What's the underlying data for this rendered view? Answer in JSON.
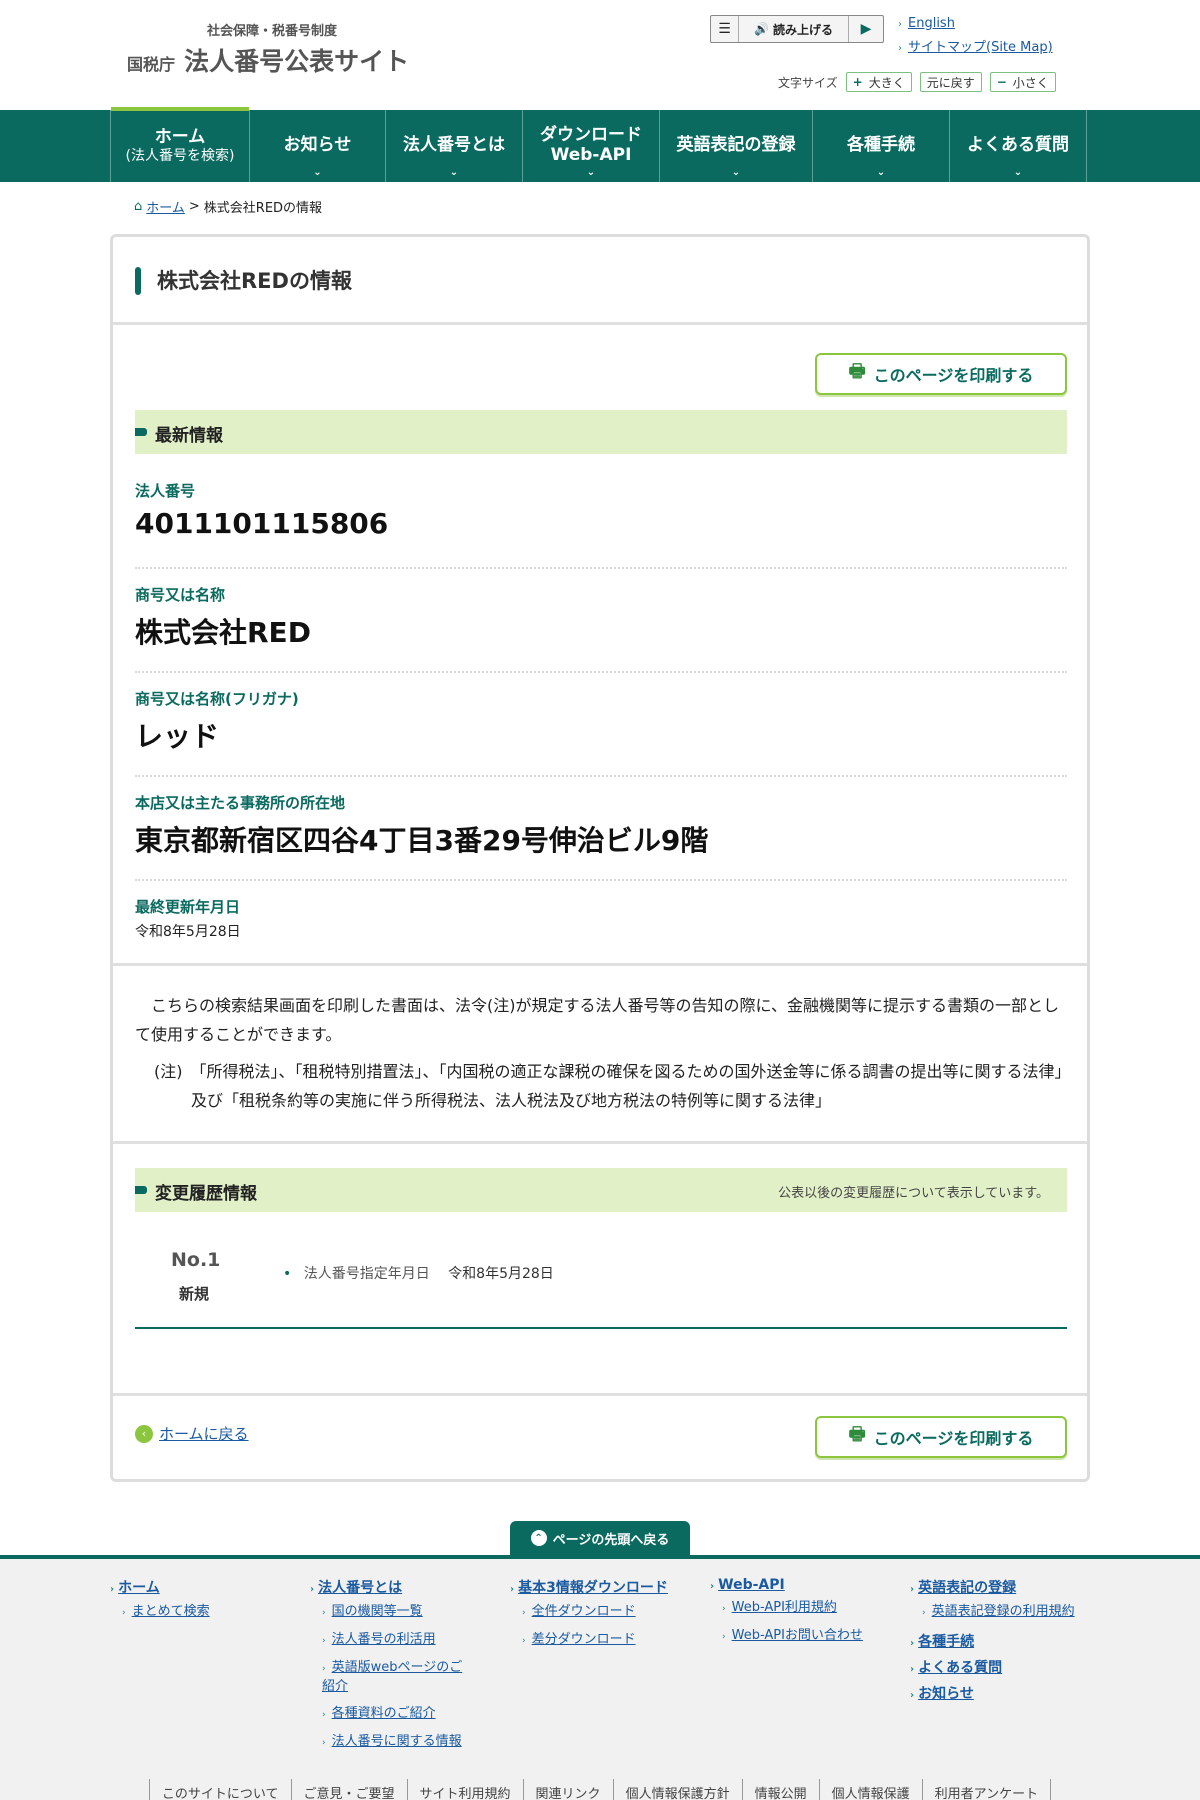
{
  "header": {
    "logo_sub": "社会保障・税番号制度",
    "logo_agency": "国税庁",
    "logo_site": "法人番号公表サイト",
    "read_aloud": "読み上げる",
    "links": [
      "English",
      "サイトマップ(Site Map)"
    ],
    "font_size_label": "文字サイズ",
    "font_buttons": [
      {
        "sym": "+",
        "label": "大きく"
      },
      {
        "sym": "",
        "label": "元に戻す"
      },
      {
        "sym": "−",
        "label": "小さく"
      }
    ]
  },
  "nav": {
    "items": [
      {
        "label": "ホーム",
        "sub": "(法人番号を検索)"
      },
      {
        "label": "お知らせ"
      },
      {
        "label": "法人番号とは"
      },
      {
        "label": "ダウンロード",
        "sub": "Web-API"
      },
      {
        "label": "英語表記の登録"
      },
      {
        "label": "各種手続"
      },
      {
        "label": "よくある質問"
      }
    ]
  },
  "breadcrumb": {
    "home": "ホーム",
    "current": "株式会社REDの情報"
  },
  "main": {
    "title": "株式会社REDの情報",
    "print_label": "このページを印刷する",
    "latest_heading": "最新情報",
    "fields": [
      {
        "label": "法人番号",
        "value": "4011101115806"
      },
      {
        "label": "商号又は名称",
        "value": "株式会社RED"
      },
      {
        "label": "商号又は名称(フリガナ)",
        "value": "レッド"
      },
      {
        "label": "本店又は主たる事務所の所在地",
        "value": "東京都新宿区四谷4丁目3番29号伸治ビル9階"
      },
      {
        "label": "最終更新年月日",
        "value": "令和8年5月28日"
      }
    ],
    "notice_main": "こちらの検索結果画面を印刷した書面は、法令(注)が規定する法人番号等の告知の際に、金融機関等に提示する書類の一部として使用することができます。",
    "notice_note": "(注)　「所得税法」、「租税特別措置法」、「内国税の適正な課税の確保を図るための国外送金等に係る調書の提出等に関する法律」及び「租税条約等の実施に伴う所得税法、法人税法及び地方税法の特例等に関する法律」",
    "history_heading": "変更履歴情報",
    "history_note": "公表以後の変更履歴について表示しています。",
    "history": [
      {
        "no": "No.1",
        "kind": "新規",
        "item_label": "法人番号指定年月日",
        "item_value": "令和8年5月28日"
      }
    ],
    "back_home": "ホームに戻る"
  },
  "pagetop": "ページの先頭へ戻る",
  "footer": {
    "columns": [
      {
        "heading": "ホーム",
        "links": [
          "まとめて検索"
        ]
      },
      {
        "heading": "法人番号とは",
        "links": [
          "国の機関等一覧",
          "法人番号の利活用",
          "英語版webページのご紹介",
          "各種資料のご紹介",
          "法人番号に関する情報"
        ]
      },
      {
        "heading": "基本3情報ダウンロード",
        "links": [
          "全件ダウンロード",
          "差分ダウンロード"
        ]
      },
      {
        "heading": "Web-API",
        "links": [
          "Web-API利用規約",
          "Web-APIお問い合わせ"
        ]
      },
      {
        "heading": "英語表記の登録",
        "links": [
          "英語表記登録の利用規約"
        ],
        "extra_headings": [
          "各種手続",
          "よくある質問",
          "お知らせ"
        ]
      }
    ],
    "bottom_links": [
      "このサイトについて",
      "ご意見・ご要望",
      "サイト利用規約",
      "関連リンク",
      "個人情報保護方針",
      "情報公開",
      "個人情報保護",
      "利用者アンケート"
    ]
  }
}
